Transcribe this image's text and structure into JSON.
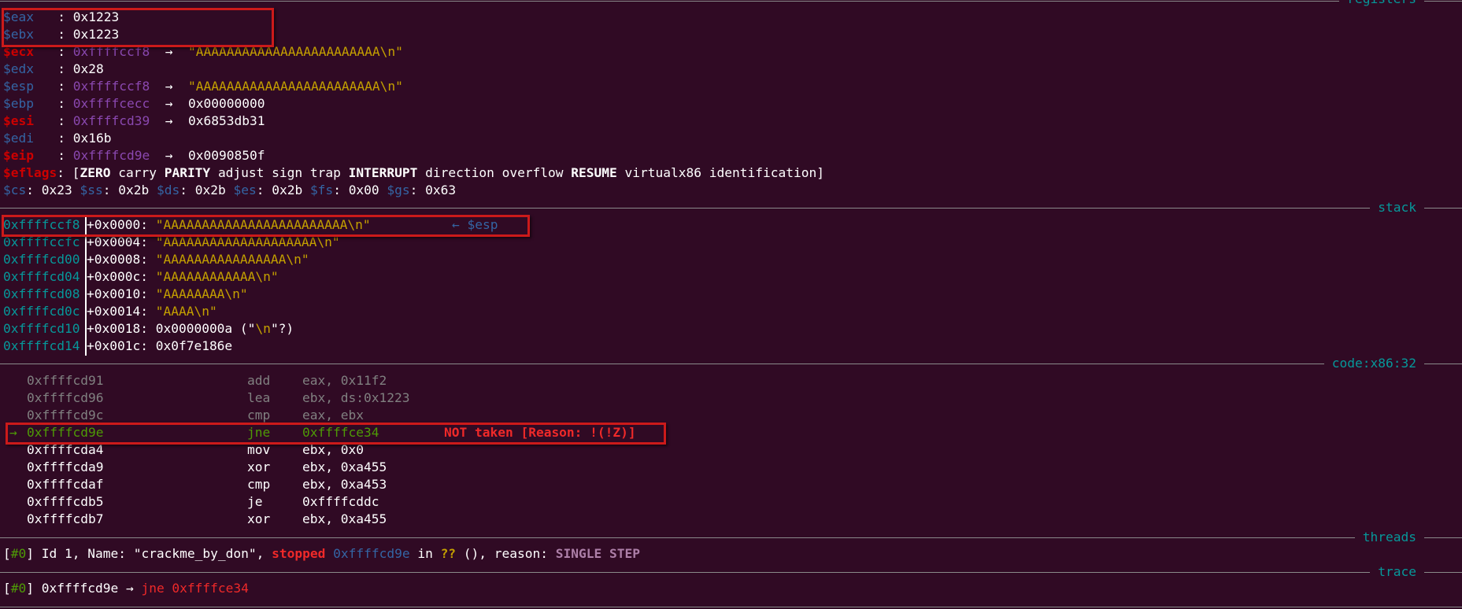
{
  "sections": {
    "registers": "registers",
    "stack": "stack",
    "code": "code:x86:32",
    "threads": "threads",
    "trace": "trace"
  },
  "registers": [
    {
      "name": "$eax",
      "value": "0x1223",
      "arrow": "",
      "target": "",
      "changed": false
    },
    {
      "name": "$ebx",
      "value": "0x1223",
      "arrow": "",
      "target": "",
      "changed": false
    },
    {
      "name": "$ecx",
      "value": "0xffffccf8",
      "arrow": "→",
      "target": "\"AAAAAAAAAAAAAAAAAAAAAAAA\\n\"",
      "changed": true
    },
    {
      "name": "$edx",
      "value": "0x28",
      "arrow": "",
      "target": "",
      "changed": false
    },
    {
      "name": "$esp",
      "value": "0xffffccf8",
      "arrow": "→",
      "target": "\"AAAAAAAAAAAAAAAAAAAAAAAA\\n\"",
      "changed": false
    },
    {
      "name": "$ebp",
      "value": "0xffffcecc",
      "arrow": "→",
      "target": "0x00000000",
      "changed": false
    },
    {
      "name": "$esi",
      "value": "0xffffcd39",
      "arrow": "→",
      "target": "0x6853db31",
      "changed": true
    },
    {
      "name": "$edi",
      "value": "0x16b",
      "arrow": "",
      "target": "",
      "changed": false
    },
    {
      "name": "$eip",
      "value": "0xffffcd9e",
      "arrow": "→",
      "target": "0x0090850f",
      "changed": true
    }
  ],
  "eflags": {
    "label": "$eflags",
    "open": ": [",
    "flags": [
      {
        "text": "ZERO",
        "set": true
      },
      {
        "text": "carry",
        "set": false
      },
      {
        "text": "PARITY",
        "set": true
      },
      {
        "text": "adjust",
        "set": false
      },
      {
        "text": "sign",
        "set": false
      },
      {
        "text": "trap",
        "set": false
      },
      {
        "text": "INTERRUPT",
        "set": true
      },
      {
        "text": "direction",
        "set": false
      },
      {
        "text": "overflow",
        "set": false
      },
      {
        "text": "RESUME",
        "set": true
      },
      {
        "text": "virtualx86",
        "set": false
      },
      {
        "text": "identification",
        "set": false
      }
    ],
    "close": "]"
  },
  "segments": [
    {
      "name": "$cs",
      "value": "0x23"
    },
    {
      "name": "$ss",
      "value": "0x2b"
    },
    {
      "name": "$ds",
      "value": "0x2b"
    },
    {
      "name": "$es",
      "value": "0x2b"
    },
    {
      "name": "$fs",
      "value": "0x00"
    },
    {
      "name": "$gs",
      "value": "0x63"
    }
  ],
  "stack": [
    {
      "addr": "0xffffccf8",
      "offset": "+0x0000:",
      "value": "\"AAAAAAAAAAAAAAAAAAAAAAAA\\n\"",
      "kind": "str",
      "note": "← $esp"
    },
    {
      "addr": "0xffffccfc",
      "offset": "+0x0004:",
      "value": "\"AAAAAAAAAAAAAAAAAAAA\\n\"",
      "kind": "str",
      "note": ""
    },
    {
      "addr": "0xffffcd00",
      "offset": "+0x0008:",
      "value": "\"AAAAAAAAAAAAAAAA\\n\"",
      "kind": "str",
      "note": ""
    },
    {
      "addr": "0xffffcd04",
      "offset": "+0x000c:",
      "value": "\"AAAAAAAAAAAA\\n\"",
      "kind": "str",
      "note": ""
    },
    {
      "addr": "0xffffcd08",
      "offset": "+0x0010:",
      "value": "\"AAAAAAAA\\n\"",
      "kind": "str",
      "note": ""
    },
    {
      "addr": "0xffffcd0c",
      "offset": "+0x0014:",
      "value": "\"AAAA\\n\"",
      "kind": "str",
      "note": ""
    },
    {
      "addr": "0xffffcd10",
      "offset": "+0x0018:",
      "value": "0x0000000a",
      "kind": "mixed",
      "extra_pre": " (\"",
      "extra_str": "\\n",
      "extra_post": "\"?)",
      "note": ""
    },
    {
      "addr": "0xffffcd14",
      "offset": "+0x001c:",
      "value": "0x0f7e186e",
      "kind": "num",
      "note": ""
    }
  ],
  "code": [
    {
      "marker": "",
      "addr": "0xffffcd91",
      "mnemonic": "add",
      "operands": "eax, 0x11f2",
      "state": "past",
      "note": ""
    },
    {
      "marker": "",
      "addr": "0xffffcd96",
      "mnemonic": "lea",
      "operands": "ebx, ds:0x1223",
      "state": "past",
      "note": ""
    },
    {
      "marker": "",
      "addr": "0xffffcd9c",
      "mnemonic": "cmp",
      "operands": "eax, ebx",
      "state": "past",
      "note": ""
    },
    {
      "marker": "→",
      "addr": "0xffffcd9e",
      "mnemonic": "jne",
      "operands": "0xffffce34",
      "state": "current",
      "note": "NOT taken [Reason: !(!Z)]"
    },
    {
      "marker": "",
      "addr": "0xffffcda4",
      "mnemonic": "mov",
      "operands": "ebx, 0x0",
      "state": "next",
      "note": ""
    },
    {
      "marker": "",
      "addr": "0xffffcda9",
      "mnemonic": "xor",
      "operands": "ebx, 0xa455",
      "state": "next",
      "note": ""
    },
    {
      "marker": "",
      "addr": "0xffffcdaf",
      "mnemonic": "cmp",
      "operands": "ebx, 0xa453",
      "state": "next",
      "note": ""
    },
    {
      "marker": "",
      "addr": "0xffffcdb5",
      "mnemonic": "je",
      "operands": "0xffffcddc",
      "state": "next",
      "note": ""
    },
    {
      "marker": "",
      "addr": "0xffffcdb7",
      "mnemonic": "xor",
      "operands": "ebx, 0xa455",
      "state": "next",
      "note": ""
    }
  ],
  "threads": {
    "open": "[",
    "id": "#0",
    "close": "]",
    "text1": " Id 1, Name: \"crackme_by_don\", ",
    "status": "stopped",
    "addr": "0xffffcd9e",
    "in": " in ",
    "func": "??",
    "text2": " (), reason: ",
    "reason": "SINGLE STEP"
  },
  "trace": {
    "open": "[",
    "id": "#0",
    "close": "]",
    "addr": " 0xffffcd9e → ",
    "insn": "jne 0xffffce34"
  },
  "colors": {
    "background": "#300a24",
    "register_name": "#3465a4",
    "register_changed": "#cc0000",
    "pointer": "#8a48b0",
    "string": "#c4a000",
    "stack_addr": "#06989a",
    "current_insn": "#4e9a06",
    "highlight_box": "#cc1a1a"
  }
}
